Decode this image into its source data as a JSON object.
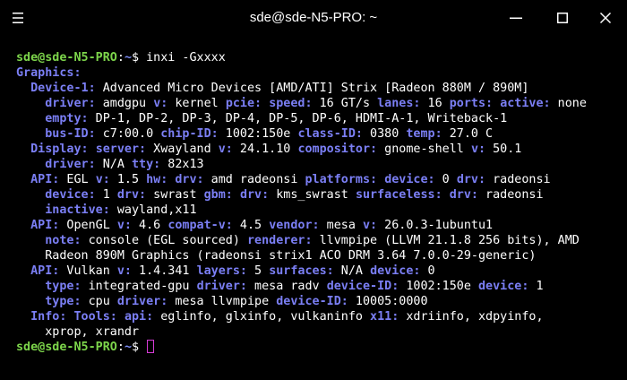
{
  "window": {
    "title": "sde@sde-N5-PRO: ~",
    "colors": {
      "background": "#000000",
      "prompt_user": "#7dd54b",
      "prompt_path": "#7b8cf5",
      "key": "#7b7ff5",
      "cursor": "#d63bd6"
    }
  },
  "titlebar": {
    "menu_icon": "hamburger-menu-icon",
    "minimize_icon": "minimize-icon",
    "maximize_icon": "maximize-icon",
    "close_icon": "close-icon"
  },
  "prompt": {
    "user_host": "sde@sde-N5-PRO",
    "colon": ":",
    "path": "~",
    "symbol": "$ "
  },
  "command": "inxi -Gxxxx",
  "output": [
    [
      [
        "k",
        "Graphics:"
      ]
    ],
    [
      [
        "v",
        "  "
      ],
      [
        "k",
        "Device-1:"
      ],
      [
        "v",
        " Advanced Micro Devices [AMD/ATI] Strix [Radeon 880M / 890M]"
      ]
    ],
    [
      [
        "v",
        "    "
      ],
      [
        "k",
        "driver:"
      ],
      [
        "v",
        " amdgpu "
      ],
      [
        "k",
        "v:"
      ],
      [
        "v",
        " kernel "
      ],
      [
        "k",
        "pcie:"
      ],
      [
        "v",
        " "
      ],
      [
        "k",
        "speed:"
      ],
      [
        "v",
        " 16 GT/s "
      ],
      [
        "k",
        "lanes:"
      ],
      [
        "v",
        " 16 "
      ],
      [
        "k",
        "ports:"
      ],
      [
        "v",
        " "
      ],
      [
        "k",
        "active:"
      ],
      [
        "v",
        " none"
      ]
    ],
    [
      [
        "v",
        "    "
      ],
      [
        "k",
        "empty:"
      ],
      [
        "v",
        " DP-1, DP-2, DP-3, DP-4, DP-5, DP-6, HDMI-A-1, Writeback-1"
      ]
    ],
    [
      [
        "v",
        "    "
      ],
      [
        "k",
        "bus-ID:"
      ],
      [
        "v",
        " c7:00.0 "
      ],
      [
        "k",
        "chip-ID:"
      ],
      [
        "v",
        " 1002:150e "
      ],
      [
        "k",
        "class-ID:"
      ],
      [
        "v",
        " 0380 "
      ],
      [
        "k",
        "temp:"
      ],
      [
        "v",
        " 27.0 C"
      ]
    ],
    [
      [
        "v",
        "  "
      ],
      [
        "k",
        "Display:"
      ],
      [
        "v",
        " "
      ],
      [
        "k",
        "server:"
      ],
      [
        "v",
        " Xwayland "
      ],
      [
        "k",
        "v:"
      ],
      [
        "v",
        " 24.1.10 "
      ],
      [
        "k",
        "compositor:"
      ],
      [
        "v",
        " gnome-shell "
      ],
      [
        "k",
        "v:"
      ],
      [
        "v",
        " 50.1"
      ]
    ],
    [
      [
        "v",
        "    "
      ],
      [
        "k",
        "driver:"
      ],
      [
        "v",
        " N/A "
      ],
      [
        "k",
        "tty:"
      ],
      [
        "v",
        " 82x13"
      ]
    ],
    [
      [
        "v",
        "  "
      ],
      [
        "k",
        "API:"
      ],
      [
        "v",
        " EGL "
      ],
      [
        "k",
        "v:"
      ],
      [
        "v",
        " 1.5 "
      ],
      [
        "k",
        "hw:"
      ],
      [
        "v",
        " "
      ],
      [
        "k",
        "drv:"
      ],
      [
        "v",
        " amd radeonsi "
      ],
      [
        "k",
        "platforms:"
      ],
      [
        "v",
        " "
      ],
      [
        "k",
        "device:"
      ],
      [
        "v",
        " 0 "
      ],
      [
        "k",
        "drv:"
      ],
      [
        "v",
        " radeonsi"
      ]
    ],
    [
      [
        "v",
        "    "
      ],
      [
        "k",
        "device:"
      ],
      [
        "v",
        " 1 "
      ],
      [
        "k",
        "drv:"
      ],
      [
        "v",
        " swrast "
      ],
      [
        "k",
        "gbm:"
      ],
      [
        "v",
        " "
      ],
      [
        "k",
        "drv:"
      ],
      [
        "v",
        " kms_swrast "
      ],
      [
        "k",
        "surfaceless:"
      ],
      [
        "v",
        " "
      ],
      [
        "k",
        "drv:"
      ],
      [
        "v",
        " radeonsi"
      ]
    ],
    [
      [
        "v",
        "    "
      ],
      [
        "k",
        "inactive:"
      ],
      [
        "v",
        " wayland,x11"
      ]
    ],
    [
      [
        "v",
        "  "
      ],
      [
        "k",
        "API:"
      ],
      [
        "v",
        " OpenGL "
      ],
      [
        "k",
        "v:"
      ],
      [
        "v",
        " 4.6 "
      ],
      [
        "k",
        "compat-v:"
      ],
      [
        "v",
        " 4.5 "
      ],
      [
        "k",
        "vendor:"
      ],
      [
        "v",
        " mesa "
      ],
      [
        "k",
        "v:"
      ],
      [
        "v",
        " 26.0.3-1ubuntu1"
      ]
    ],
    [
      [
        "v",
        "    "
      ],
      [
        "k",
        "note:"
      ],
      [
        "v",
        " console (EGL sourced) "
      ],
      [
        "k",
        "renderer:"
      ],
      [
        "v",
        " llvmpipe (LLVM 21.1.8 256 bits), AMD"
      ]
    ],
    [
      [
        "v",
        "    Radeon 890M Graphics (radeonsi strix1 ACO DRM 3.64 7.0.0-29-generic)"
      ]
    ],
    [
      [
        "v",
        "  "
      ],
      [
        "k",
        "API:"
      ],
      [
        "v",
        " Vulkan "
      ],
      [
        "k",
        "v:"
      ],
      [
        "v",
        " 1.4.341 "
      ],
      [
        "k",
        "layers:"
      ],
      [
        "v",
        " 5 "
      ],
      [
        "k",
        "surfaces:"
      ],
      [
        "v",
        " N/A "
      ],
      [
        "k",
        "device:"
      ],
      [
        "v",
        " 0"
      ]
    ],
    [
      [
        "v",
        "    "
      ],
      [
        "k",
        "type:"
      ],
      [
        "v",
        " integrated-gpu "
      ],
      [
        "k",
        "driver:"
      ],
      [
        "v",
        " mesa radv "
      ],
      [
        "k",
        "device-ID:"
      ],
      [
        "v",
        " 1002:150e "
      ],
      [
        "k",
        "device:"
      ],
      [
        "v",
        " 1"
      ]
    ],
    [
      [
        "v",
        "    "
      ],
      [
        "k",
        "type:"
      ],
      [
        "v",
        " cpu "
      ],
      [
        "k",
        "driver:"
      ],
      [
        "v",
        " mesa llvmpipe "
      ],
      [
        "k",
        "device-ID:"
      ],
      [
        "v",
        " 10005:0000"
      ]
    ],
    [
      [
        "v",
        "  "
      ],
      [
        "k",
        "Info:"
      ],
      [
        "v",
        " "
      ],
      [
        "k",
        "Tools:"
      ],
      [
        "v",
        " "
      ],
      [
        "k",
        "api:"
      ],
      [
        "v",
        " eglinfo, glxinfo, vulkaninfo "
      ],
      [
        "k",
        "x11:"
      ],
      [
        "v",
        " xdriinfo, xdpyinfo,"
      ]
    ],
    [
      [
        "v",
        "    xprop, xrandr"
      ]
    ]
  ]
}
